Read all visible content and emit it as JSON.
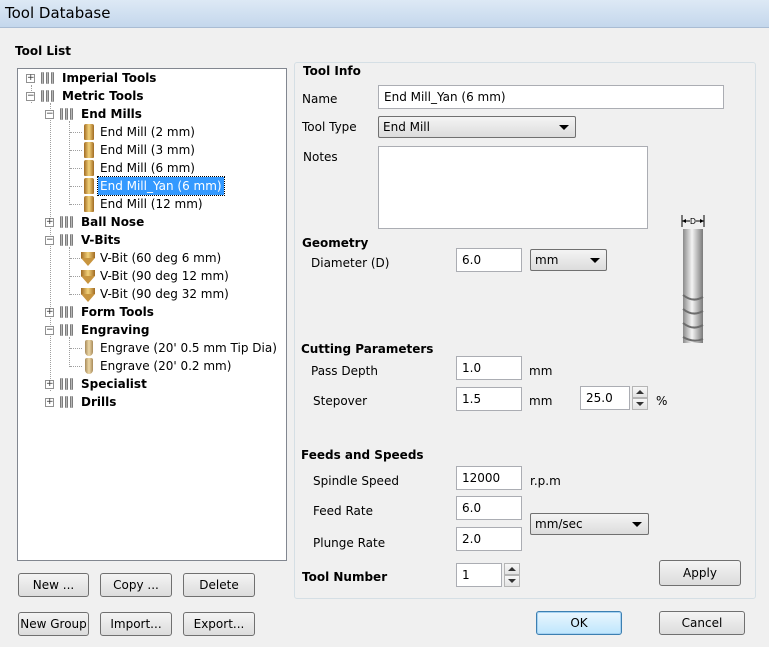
{
  "window": {
    "title": "Tool Database"
  },
  "tool_list": {
    "heading": "Tool List",
    "tree": [
      {
        "label": "Imperial Tools",
        "bold": true,
        "expanded": false
      },
      {
        "label": "Metric Tools",
        "bold": true,
        "expanded": true
      },
      {
        "label": "End Mills",
        "bold": true,
        "expanded": true
      },
      {
        "label": "End Mill (2 mm)"
      },
      {
        "label": "End Mill (3 mm)"
      },
      {
        "label": "End Mill (6 mm)"
      },
      {
        "label": "End Mill_Yan (6 mm)",
        "selected": true
      },
      {
        "label": "End Mill (12 mm)"
      },
      {
        "label": "Ball Nose",
        "bold": true,
        "expanded": false
      },
      {
        "label": "V-Bits",
        "bold": true,
        "expanded": true
      },
      {
        "label": "V-Bit (60 deg 6 mm)"
      },
      {
        "label": "V-Bit (90 deg 12 mm)"
      },
      {
        "label": "V-Bit (90 deg 32 mm)"
      },
      {
        "label": "Form Tools",
        "bold": true,
        "expanded": false
      },
      {
        "label": "Engraving",
        "bold": true,
        "expanded": true
      },
      {
        "label": "Engrave (20' 0.5 mm Tip Dia)"
      },
      {
        "label": "Engrave (20' 0.2 mm)"
      },
      {
        "label": "Specialist",
        "bold": true,
        "expanded": false
      },
      {
        "label": "Drills",
        "bold": true,
        "expanded": false
      }
    ],
    "buttons": {
      "new": "New ...",
      "copy": "Copy ...",
      "delete": "Delete",
      "new_group": "New Group",
      "import": "Import...",
      "export": "Export..."
    }
  },
  "tool_info": {
    "heading": "Tool Info",
    "name_label": "Name",
    "name_value": "End Mill_Yan (6 mm)",
    "type_label": "Tool Type",
    "type_value": "End Mill",
    "notes_label": "Notes",
    "notes_value": "",
    "diagram_label": "D"
  },
  "geometry": {
    "heading": "Geometry",
    "diameter_label": "Diameter (D)",
    "diameter_value": "6.0",
    "unit_value": "mm"
  },
  "cutting": {
    "heading": "Cutting Parameters",
    "pass_depth_label": "Pass Depth",
    "pass_depth_value": "1.0",
    "pass_depth_unit": "mm",
    "stepover_label": "Stepover",
    "stepover_value": "1.5",
    "stepover_unit": "mm",
    "stepover_percent_value": "25.0",
    "percent_sign": "%"
  },
  "feeds": {
    "heading": "Feeds and Speeds",
    "spindle_label": "Spindle Speed",
    "spindle_value": "12000",
    "spindle_unit": "r.p.m",
    "feed_label": "Feed Rate",
    "feed_value": "6.0",
    "plunge_label": "Plunge Rate",
    "plunge_value": "2.0",
    "rate_unit_value": "mm/sec"
  },
  "tool_number": {
    "label": "Tool Number",
    "value": "1"
  },
  "actions": {
    "apply": "Apply",
    "ok": "OK",
    "cancel": "Cancel"
  }
}
